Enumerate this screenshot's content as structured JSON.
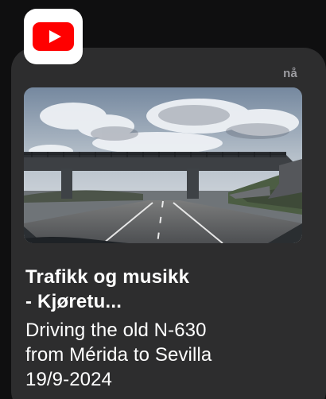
{
  "app": {
    "name": "YouTube",
    "icon": "youtube-icon",
    "brand_color": "#FF0000"
  },
  "notification": {
    "timestamp": "nå",
    "title": "Trafikk og musikk\n- Kjøretu...",
    "body": "Driving the old N-630\nfrom Mérida to Sevilla\n19/9-2024",
    "thumbnail": "video-thumbnail-highway-overpass"
  }
}
